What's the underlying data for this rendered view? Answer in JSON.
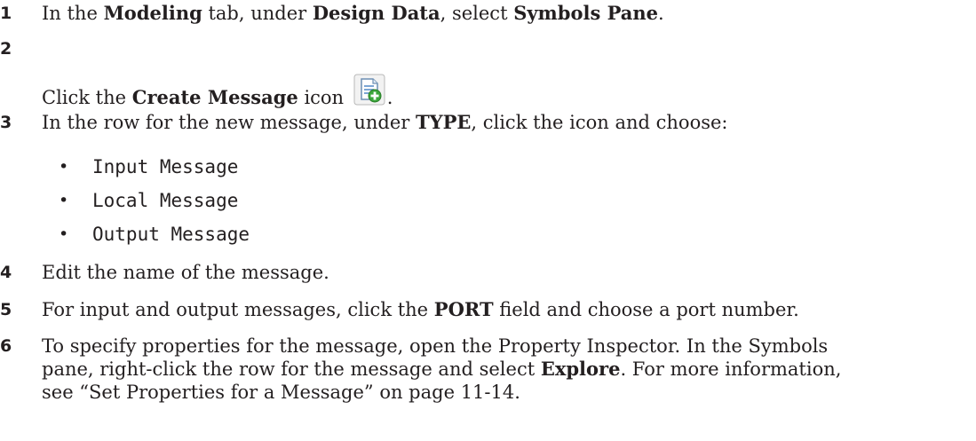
{
  "steps": [
    {
      "number": "1",
      "pre1": "In the ",
      "b1": "Modeling",
      "mid1": " tab, under ",
      "b2": "Design Data",
      "mid2": ", select ",
      "b3": "Symbols Pane",
      "post": "."
    },
    {
      "number": "2",
      "pre1": "Click the ",
      "b1": "Create Message",
      "mid1": " icon ",
      "post": ".",
      "icon": "create-message-icon"
    },
    {
      "number": "3",
      "pre1": "In the row for the new message, under ",
      "b1": "TYPE",
      "post": ", click the icon and choose:",
      "options": [
        "Input Message",
        "Local Message",
        "Output Message"
      ]
    },
    {
      "number": "4",
      "text": "Edit the name of the message."
    },
    {
      "number": "5",
      "pre1": "For input and output messages, click the ",
      "b1": "PORT",
      "post": " field and choose a port number."
    },
    {
      "number": "6",
      "line1": "To specify properties for the message, open the Property Inspector. In the Symbols",
      "line2_pre": "pane, right-click the row for the message and select ",
      "line2_b": "Explore",
      "line2_post": ". For more information,",
      "line3": "see “Set Properties for a Message” on page 11-14."
    }
  ],
  "colors": {
    "text": "#231f20",
    "icon_green": "#3aa63a",
    "icon_blue": "#5b8fc9"
  }
}
